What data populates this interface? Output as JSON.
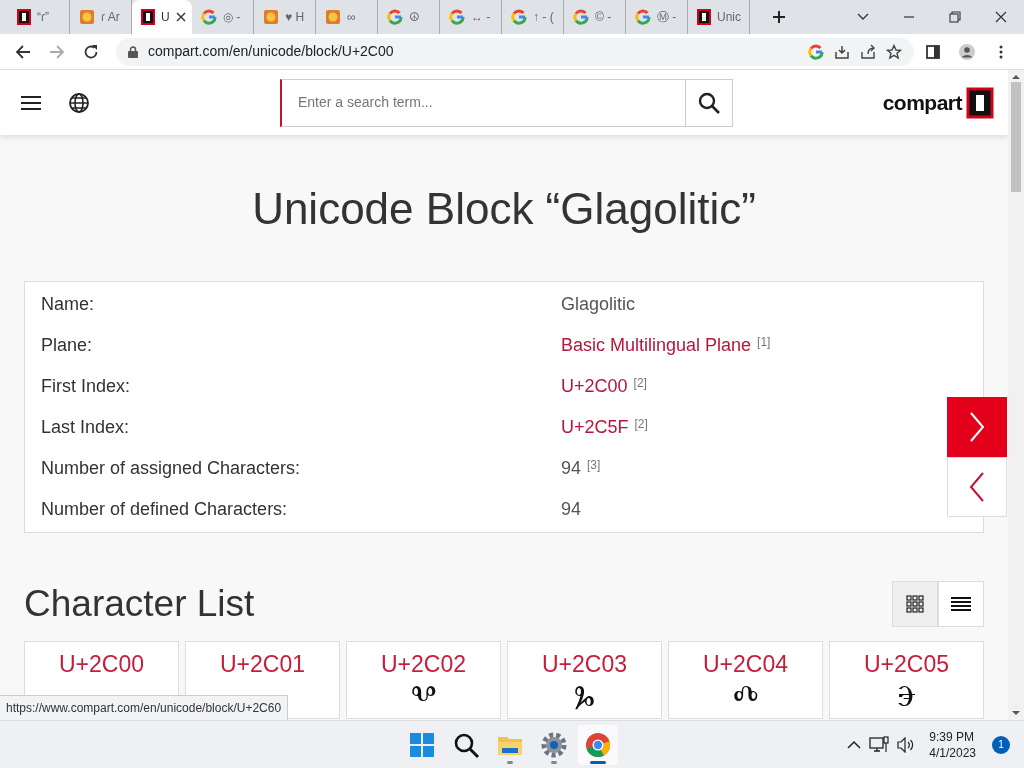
{
  "browser": {
    "tabs": [
      {
        "title": "“ɾ”",
        "kind": "compart",
        "selected": false
      },
      {
        "title": "ɾ Ar",
        "kind": "emoji",
        "selected": false
      },
      {
        "title": "U",
        "kind": "compart",
        "selected": true
      },
      {
        "title": "◎ -",
        "kind": "google",
        "selected": false
      },
      {
        "title": "♥ H",
        "kind": "emoji",
        "selected": false
      },
      {
        "title": "∞",
        "kind": "emoji",
        "selected": false
      },
      {
        "title": "☮",
        "kind": "google",
        "selected": false
      },
      {
        "title": "↔ -",
        "kind": "google",
        "selected": false
      },
      {
        "title": "↑ - (",
        "kind": "google",
        "selected": false
      },
      {
        "title": "© -",
        "kind": "google",
        "selected": false
      },
      {
        "title": "Ⓜ -",
        "kind": "google",
        "selected": false
      },
      {
        "title": "Unic",
        "kind": "compart",
        "selected": false
      }
    ],
    "address": "compart.com/en/unicode/block/U+2C00",
    "status_url": "https://www.compart.com/en/unicode/block/U+2C60"
  },
  "header": {
    "search": {
      "placeholder": "Enter a search term..."
    },
    "logo": "compart"
  },
  "page": {
    "title": "Unicode Block “Glagolitic”",
    "properties": [
      {
        "label": "Name:",
        "value": "Glagolitic",
        "link": false
      },
      {
        "label": "Plane:",
        "value": "Basic Multilingual Plane",
        "link": true,
        "note": "[1]"
      },
      {
        "label": "First Index:",
        "value": "U+2C00",
        "link": true,
        "note": "[2]"
      },
      {
        "label": "Last Index:",
        "value": "U+2C5F",
        "link": true,
        "note": "[2]"
      },
      {
        "label": "Number of assigned Characters:",
        "value": "94",
        "link": false,
        "note": "[3]"
      },
      {
        "label": "Number of defined Characters:",
        "value": "94",
        "link": false
      }
    ],
    "section_title": "Character List",
    "view_modes": [
      {
        "kind": "grid",
        "selected": true
      },
      {
        "kind": "list",
        "selected": false
      }
    ],
    "characters": [
      {
        "code": "U+2C00"
      },
      {
        "code": "U+2C01"
      },
      {
        "code": "U+2C02",
        "glyph": "Ⰲ"
      },
      {
        "code": "U+2C03",
        "glyph": "Ⰳ"
      },
      {
        "code": "U+2C04",
        "glyph": "Ⰴ"
      },
      {
        "code": "U+2C05",
        "glyph": "Ⰵ"
      }
    ]
  },
  "taskbar": {
    "apps": [
      {
        "kind": "start",
        "running": false,
        "selected": false
      },
      {
        "kind": "search",
        "running": false,
        "selected": false
      },
      {
        "kind": "folder",
        "running": true,
        "selected": false
      },
      {
        "kind": "settings",
        "running": true,
        "selected": false
      },
      {
        "kind": "chrome",
        "running": true,
        "selected": true
      }
    ],
    "time": "9:39 PM",
    "date": "4/1/2023",
    "notifications": "1"
  }
}
